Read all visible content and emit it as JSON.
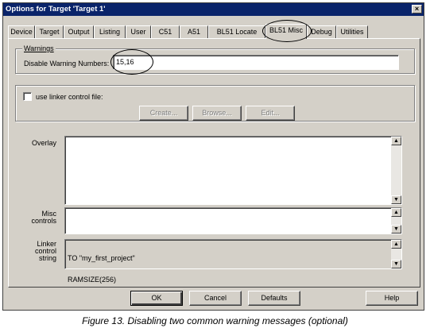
{
  "window": {
    "title": "Options for Target 'Target 1'",
    "close_glyph": "×"
  },
  "tabs": [
    {
      "label": "Device"
    },
    {
      "label": "Target"
    },
    {
      "label": "Output"
    },
    {
      "label": "Listing"
    },
    {
      "label": "User"
    },
    {
      "label": "C51"
    },
    {
      "label": "A51"
    },
    {
      "label": "BL51 Locate"
    },
    {
      "label": "BL51 Misc",
      "active": true
    },
    {
      "label": "Debug"
    },
    {
      "label": "Utilities"
    }
  ],
  "warnings": {
    "group_label": "Warnings",
    "disable_label": "Disable Warning Numbers:",
    "disable_value": "15,16"
  },
  "linker_file": {
    "checkbox_label": "use linker control file:",
    "checked": false,
    "create_label": "Create...",
    "browse_label": "Browse...",
    "edit_label": "Edit..."
  },
  "overlay": {
    "label": "Overlay",
    "value": ""
  },
  "misc_controls": {
    "label_line1": "Misc",
    "label_line2": "controls",
    "value": ""
  },
  "linker_control_string": {
    "label_line1": "Linker",
    "label_line2": "control",
    "label_line3": "string",
    "line1": "TO \"my_first_project\"",
    "line2": "RAMSIZE(256)"
  },
  "footer": {
    "ok_label": "OK",
    "cancel_label": "Cancel",
    "defaults_label": "Defaults",
    "help_label": "Help"
  },
  "caption": "Figure 13. Disabling two common warning messages (optional)"
}
